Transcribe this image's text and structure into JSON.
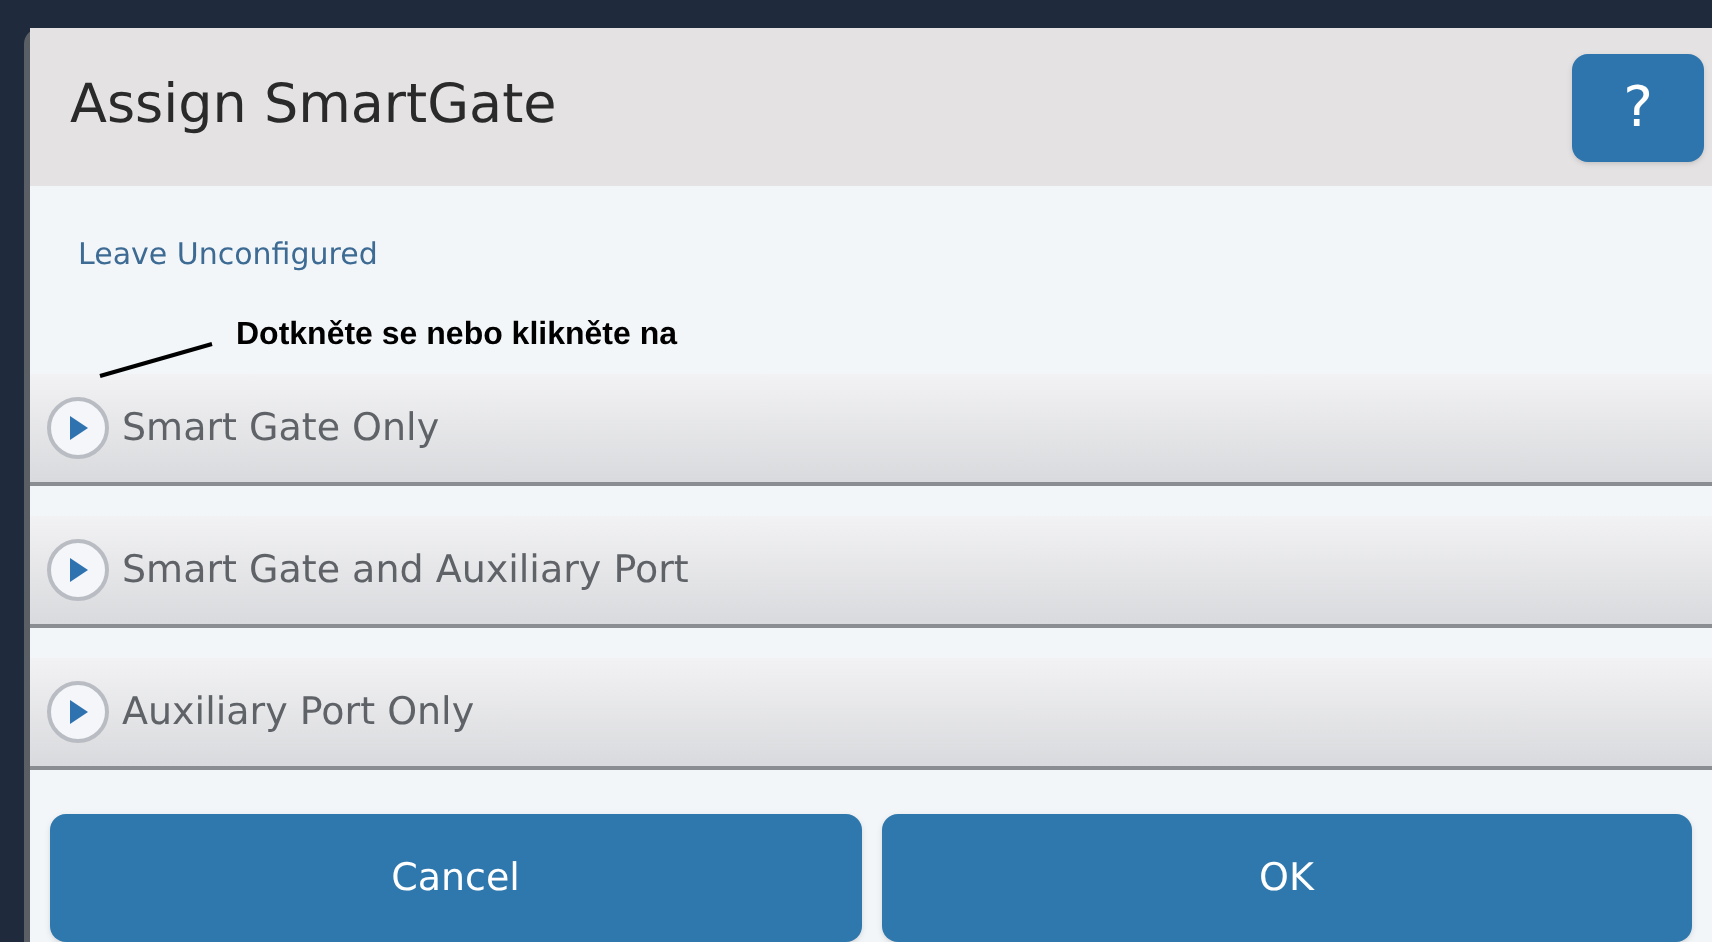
{
  "dialog": {
    "title": "Assign SmartGate",
    "help_button": "?"
  },
  "link": "Leave Unconfigured",
  "annotation": "Dotkněte se nebo klikněte na",
  "options": [
    {
      "label": "Smart Gate Only"
    },
    {
      "label": "Smart Gate and Auxiliary Port"
    },
    {
      "label": "Auxiliary Port Only"
    }
  ],
  "buttons": [
    {
      "label": "Cancel"
    },
    {
      "label": "OK"
    }
  ]
}
